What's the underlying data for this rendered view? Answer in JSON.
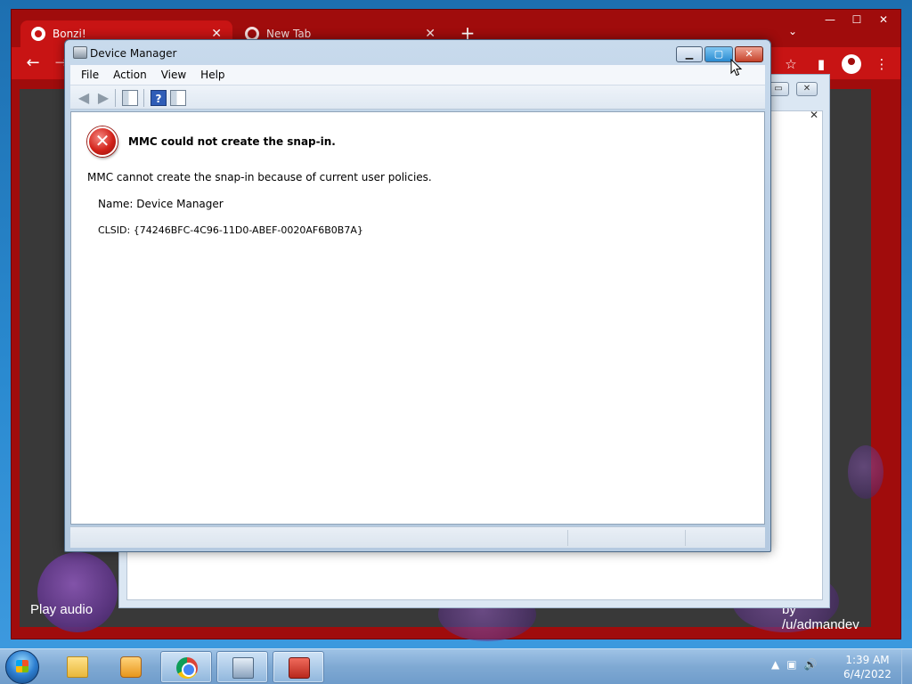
{
  "browser": {
    "tabs": [
      {
        "title": "Bonzi!",
        "active": true
      },
      {
        "title": "New Tab",
        "active": false
      }
    ],
    "new_tab_glyph": "+",
    "window_controls": {
      "minimize": "—",
      "maximize": "☐",
      "close": "✕"
    },
    "icons": [
      "back-icon",
      "forward-icon",
      "star-icon",
      "side-panel-icon",
      "profile-icon",
      "kebab-menu-icon"
    ]
  },
  "video": {
    "left_label": "Play audio",
    "right_label": "by /u/admandev"
  },
  "mmc": {
    "title": "Device Manager",
    "menu": [
      "File",
      "Action",
      "View",
      "Help"
    ],
    "error_title": "MMC could not create the snap-in.",
    "error_message": "MMC cannot create the snap-in because of current user policies.",
    "name_line": "Name: Device Manager",
    "clsid_line": "CLSID: {74246BFC-4C96-11D0-ABEF-0020AF6B0B7A}"
  },
  "taskbar": {
    "time": "1:39 AM",
    "date": "6/4/2022",
    "apps": [
      "windows-explorer",
      "windows-media-player",
      "google-chrome",
      "network-connections",
      "device-manager-toolbox"
    ]
  },
  "colors": {
    "chrome_frame": "#a00c0c",
    "chrome_tab_active": "#c81414",
    "error_red": "#d2221a",
    "taskbar": "#7fa9d3"
  }
}
